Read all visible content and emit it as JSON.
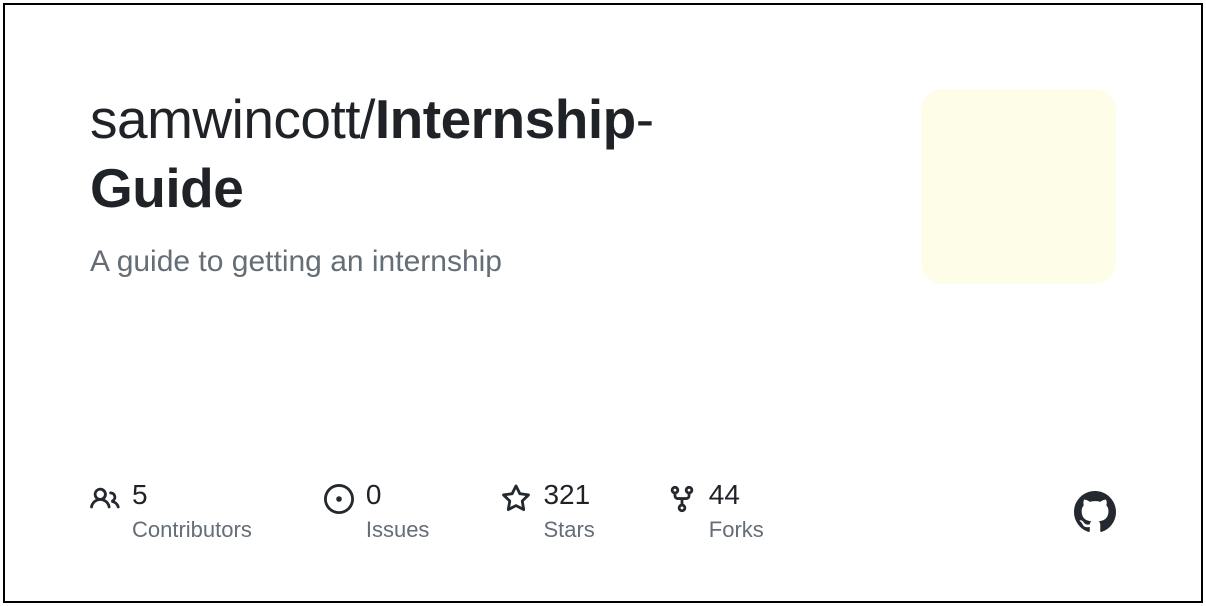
{
  "repo": {
    "owner": "samwincott",
    "separator": "/",
    "name_part1": "Internship",
    "hyphen": "-",
    "name_part2": "Guide",
    "description": "A guide to getting an internship"
  },
  "stats": {
    "contributors": {
      "value": "5",
      "label": "Contributors"
    },
    "issues": {
      "value": "0",
      "label": "Issues"
    },
    "stars": {
      "value": "321",
      "label": "Stars"
    },
    "forks": {
      "value": "44",
      "label": "Forks"
    }
  },
  "colors": {
    "avatar_bg": "#fdfde8",
    "text_primary": "#1f2328",
    "text_muted": "#656d76"
  }
}
